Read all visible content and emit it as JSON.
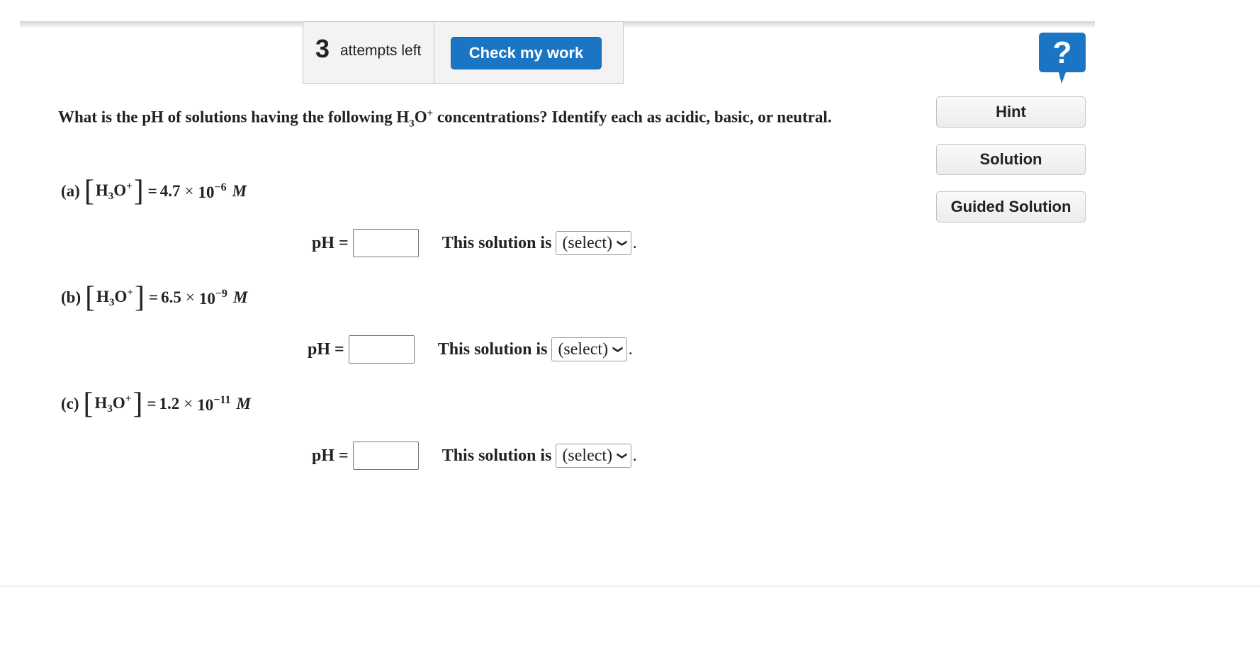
{
  "toolbar": {
    "attempts_count": "3",
    "attempts_label": "attempts left",
    "check_label": "Check my work",
    "help_symbol": "?"
  },
  "sidebar": {
    "hint": "Hint",
    "solution": "Solution",
    "guided": "Guided Solution"
  },
  "question": {
    "part1": "What is the pH of solutions having the following H",
    "sub": "3",
    "part2": "O",
    "sup": "+",
    "part3": " concentrations? Identify each as acidic, basic, or neutral."
  },
  "parts": [
    {
      "letter": "(a)",
      "h": "H",
      "sub": "3",
      "o": "O",
      "sup": "+",
      "equals": "=",
      "mantissa": "4.7",
      "times": "×",
      "base": "10",
      "exponent": "−6",
      "unit": "M",
      "ph_label": "pH =",
      "ph_value": "",
      "sol_text": "This solution is",
      "select_value": "(select)",
      "period": "."
    },
    {
      "letter": "(b)",
      "h": "H",
      "sub": "3",
      "o": "O",
      "sup": "+",
      "equals": "=",
      "mantissa": "6.5",
      "times": "×",
      "base": "10",
      "exponent": "−9",
      "unit": "M",
      "ph_label": "pH =",
      "ph_value": "",
      "sol_text": "This solution is",
      "select_value": "(select)",
      "period": "."
    },
    {
      "letter": "(c)",
      "h": "H",
      "sub": "3",
      "o": "O",
      "sup": "+",
      "equals": "=",
      "mantissa": "1.2",
      "times": "×",
      "base": "10",
      "exponent": "−11",
      "unit": "M",
      "ph_label": "pH =",
      "ph_value": "",
      "sol_text": "This solution is",
      "select_value": "(select)",
      "period": "."
    }
  ],
  "colors": {
    "primary_button": "#1a75c4",
    "help_icon": "#1a75c4"
  },
  "icons": {
    "help": "question-mark-speech-bubble-icon",
    "dropdown": "chevron-down-icon"
  }
}
